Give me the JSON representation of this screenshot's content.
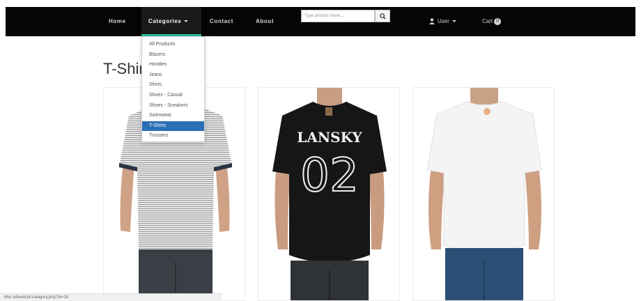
{
  "nav": {
    "home": "Home",
    "categories": "Categories",
    "contact": "Contact",
    "about": "About",
    "search_placeholder": "Type product name...",
    "user": "User",
    "cart": "Cart",
    "cart_count": "0"
  },
  "categories_menu": {
    "items": [
      "All Products",
      "Blazers",
      "Hoodies",
      "Jeans",
      "Shirts",
      "Shoes - Casual",
      "Shoes - Sneakers",
      "Swimwear",
      "T-Shirts",
      "Trousers"
    ],
    "selected_index": 8
  },
  "page": {
    "title": "T-Shirts"
  },
  "products": [
    {
      "image": "striped-t-shirt-photo",
      "shirt_color": "#d7d7d7"
    },
    {
      "image": "black-lansky-02-t-shirt-photo",
      "shirt_color": "#1a1a1a",
      "print_name": "LANSKY",
      "print_number": "02"
    },
    {
      "image": "white-t-shirt-photo",
      "shirt_color": "#f3f3f3"
    }
  ],
  "status_bar": {
    "url": "dhe.nd/web/pr/category.php?id=19"
  },
  "colors": {
    "navbar": "#050505",
    "accent": "#28c0a0",
    "selected": "#2d6fb7"
  }
}
